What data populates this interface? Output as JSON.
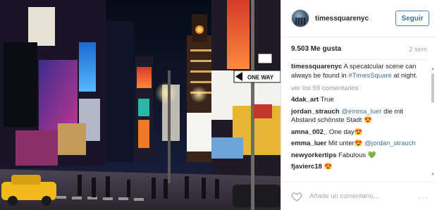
{
  "post": {
    "username": "timessquarenyc",
    "follow_label": "Seguir",
    "likes_text": "9.503 Me gusta",
    "time_ago": "2 sem",
    "caption": {
      "author": "timessquarenyc",
      "text_before": "A specatcular scene can always be found in ",
      "hashtag": "#TimesSquare",
      "text_after": " at night."
    },
    "view_all_comments": "ver los 59 comentarios",
    "comments": [
      {
        "user": "4dak_art",
        "text": "True",
        "mention": "",
        "text_after": ""
      },
      {
        "user": "jordan_strauch",
        "text": "",
        "mention": "@emma_luer",
        "text_after": " die mit Abstand schönste Stadt 😍"
      },
      {
        "user": "amna_002_",
        "text": "One day😍",
        "mention": "",
        "text_after": ""
      },
      {
        "user": "emma_luer",
        "text": "Mit unter😍 ",
        "mention": "@jordan_strauch",
        "text_after": ""
      },
      {
        "user": "newyorkertips",
        "text": "Fabulous 💚",
        "mention": "",
        "text_after": ""
      },
      {
        "user": "fjavierc18",
        "text": "😍",
        "mention": "",
        "text_after": ""
      }
    ],
    "add_comment_placeholder": "Añade un comentario...",
    "more_options": "···"
  },
  "photo": {
    "signs": {
      "one_way": "ONE WAY",
      "broadway_arrow": "←"
    }
  },
  "icons": {
    "heart": "heart-icon",
    "more": "ellipsis-icon",
    "scroll_up": "chevron-up-icon",
    "scroll_down": "chevron-down-icon"
  },
  "colors": {
    "link": "#3f729b",
    "follow_border": "#4f88c6",
    "muted": "#a5a7aa"
  }
}
